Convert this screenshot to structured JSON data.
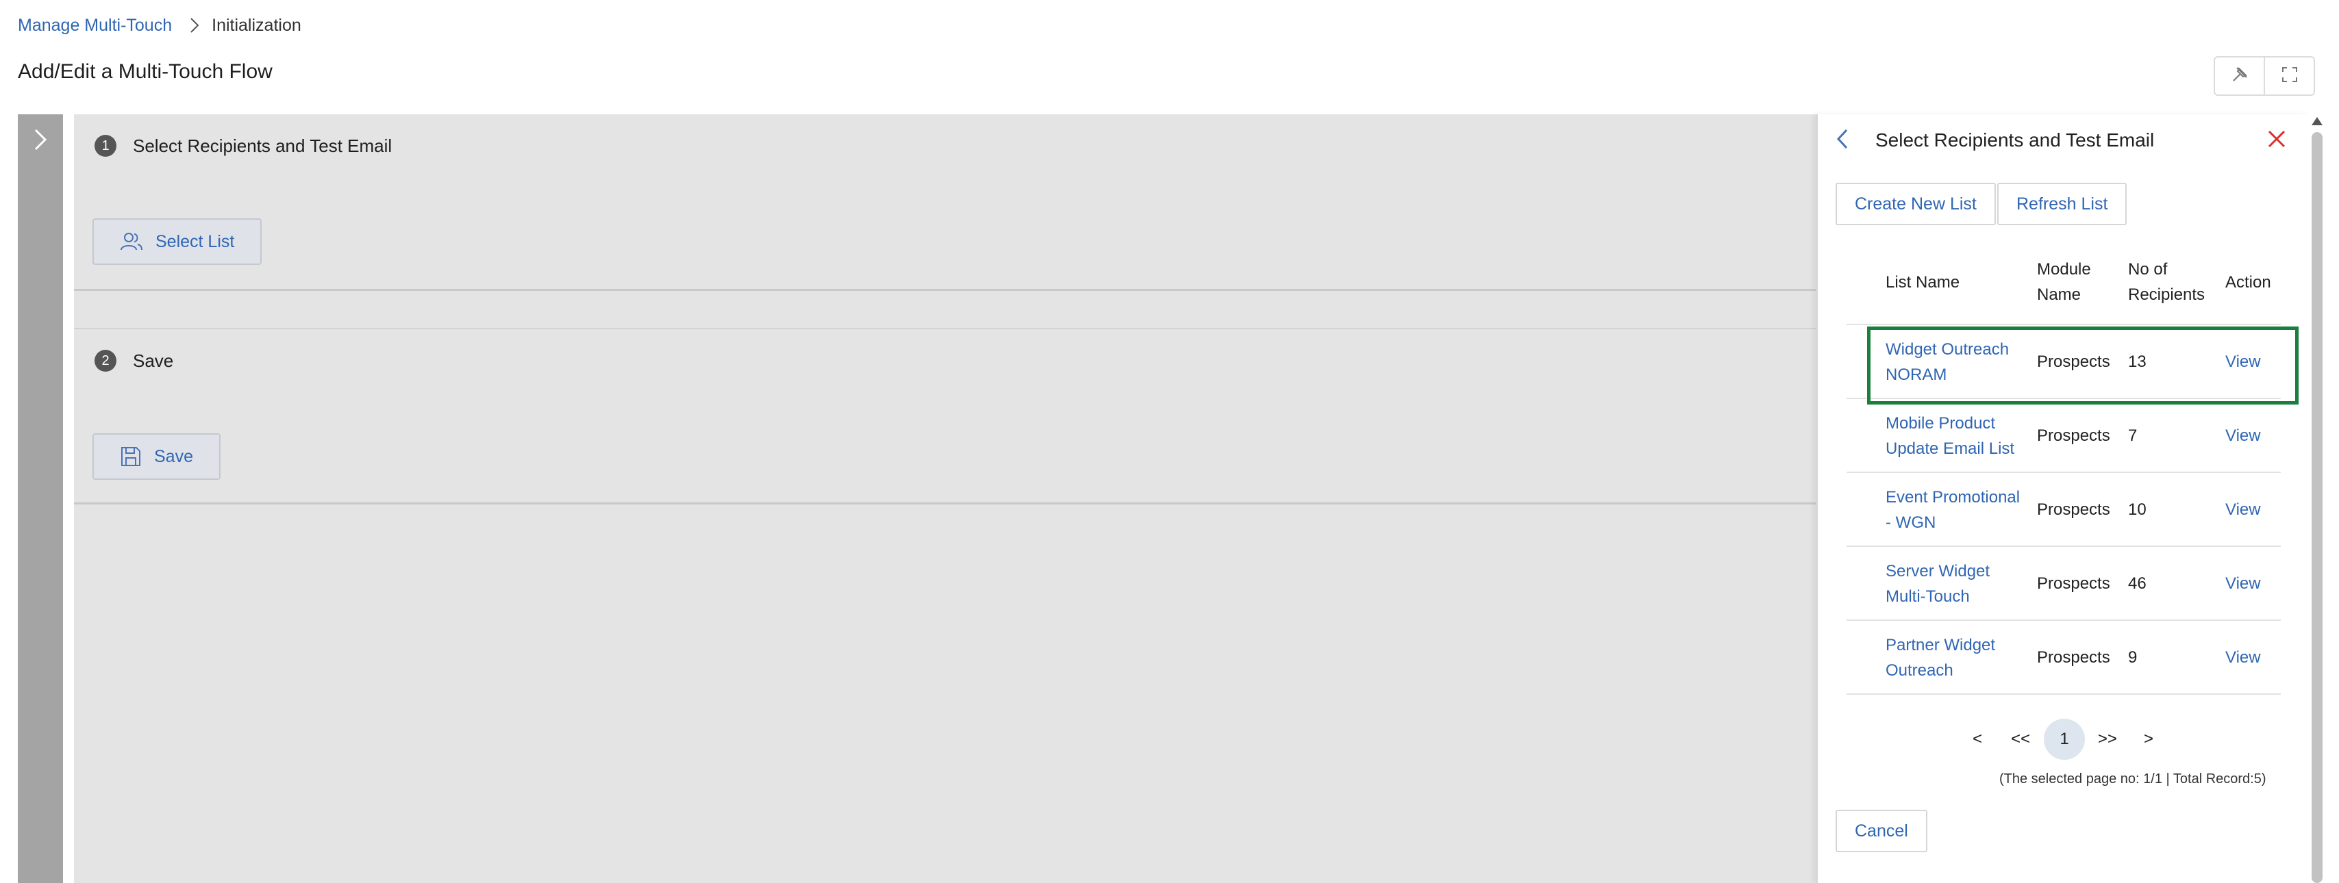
{
  "breadcrumb": {
    "parent": "Manage Multi-Touch",
    "current": "Initialization"
  },
  "page": {
    "title": "Add/Edit a Multi-Touch Flow"
  },
  "steps": [
    {
      "number": "1",
      "title": "Select Recipients and Test Email",
      "button": "Select List",
      "icon": "users-icon"
    },
    {
      "number": "2",
      "title": "Save",
      "button": "Save",
      "icon": "save-icon"
    }
  ],
  "panel": {
    "title": "Select Recipients and Test Email",
    "create_label": "Create New List",
    "refresh_label": "Refresh List",
    "columns": {
      "name": "List Name",
      "module_1": "Module",
      "module_2": "Name",
      "count_1": "No of",
      "count_2": "Recipients",
      "action": "Action"
    },
    "rows": [
      {
        "name_1": "Widget Outreach",
        "name_2": "NORAM",
        "module": "Prospects",
        "count": "13",
        "action": "View",
        "selected": true
      },
      {
        "name_1": "Mobile Product",
        "name_2": "Update Email List",
        "module": "Prospects",
        "count": "7",
        "action": "View",
        "selected": false
      },
      {
        "name_1": "Event Promotional",
        "name_2": "- WGN",
        "module": "Prospects",
        "count": "10",
        "action": "View",
        "selected": false
      },
      {
        "name_1": "Server Widget",
        "name_2": "Multi-Touch",
        "module": "Prospects",
        "count": "46",
        "action": "View",
        "selected": false
      },
      {
        "name_1": "Partner Widget",
        "name_2": "Outreach",
        "module": "Prospects",
        "count": "9",
        "action": "View",
        "selected": false
      }
    ],
    "pager": {
      "prev": "<",
      "first": "<<",
      "current": "1",
      "last": ">>",
      "next": ">",
      "info": "(The selected page no: 1/1 | Total Record:5)"
    },
    "cancel_label": "Cancel"
  },
  "colors": {
    "link": "#2f66b3",
    "selected_border": "#1a7f3c",
    "close": "#d9302c"
  }
}
